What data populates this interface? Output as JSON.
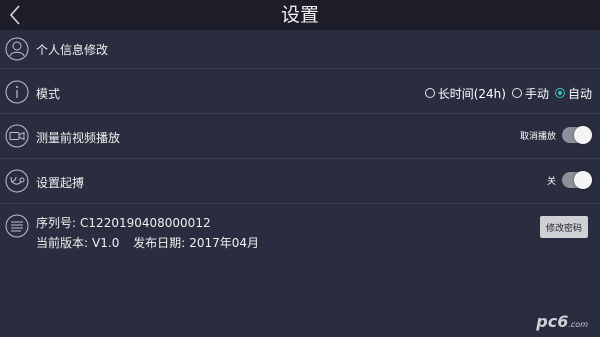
{
  "header": {
    "title": "设置",
    "back_icon": "chevron-left-icon"
  },
  "rows": {
    "profile": {
      "label": "个人信息修改",
      "icon": "user-icon"
    },
    "mode": {
      "label": "模式",
      "icon": "info-icon",
      "options": [
        "长时间(24h)",
        "手动",
        "自动"
      ],
      "selected": "自动"
    },
    "video": {
      "label": "测量前视频播放",
      "icon": "video-camera-icon",
      "toggle_label": "取消播放"
    },
    "setup": {
      "label": "设置起搏",
      "icon": "stethoscope-icon",
      "toggle_label": "关"
    },
    "device": {
      "icon": "document-lines-icon",
      "serial_label": "序列号:",
      "serial_value": "C1220190408000012",
      "version_label": "当前版本:",
      "version_value": "V1.0",
      "release_label": "发布日期:",
      "release_value": "2017年04月",
      "change_password": "修改密码"
    }
  },
  "watermark": {
    "text": "pc6",
    "suffix": ".com"
  },
  "colors": {
    "background": "#2a2d3f",
    "topbar": "#1c1d29",
    "accent": "#39c3b9"
  }
}
